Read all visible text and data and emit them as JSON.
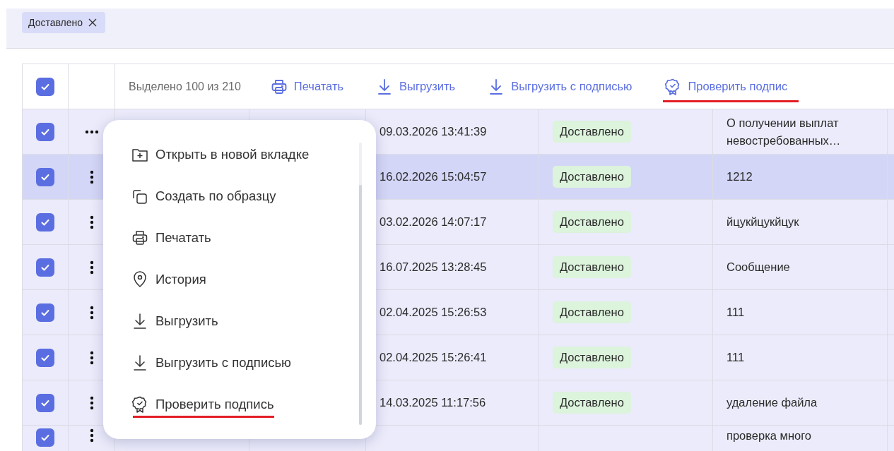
{
  "filter_chips": [
    {
      "label": "Доставлено"
    }
  ],
  "table": {
    "header": {
      "all_checked": true,
      "selection_text": "Выделено 100 из 210",
      "actions": [
        {
          "label": "Печатать",
          "underlined": false
        },
        {
          "label": "Выгрузить",
          "underlined": false
        },
        {
          "label": "Выгрузить с подписью",
          "underlined": false
        },
        {
          "label": "Проверить подпис",
          "underlined": true
        }
      ]
    },
    "rows": [
      {
        "checked": true,
        "menu_open": true,
        "highlighted": false,
        "date": "09.03.2026 13:41:39",
        "status": "Доставлено",
        "subject": "О получении выплат невостребованных…"
      },
      {
        "checked": true,
        "menu_open": false,
        "highlighted": true,
        "date": "16.02.2026 15:04:57",
        "status": "Доставлено",
        "subject": "1212"
      },
      {
        "checked": true,
        "menu_open": false,
        "highlighted": false,
        "date": "03.02.2026 14:07:17",
        "status": "Доставлено",
        "subject": "йцукйцукйцук"
      },
      {
        "checked": true,
        "menu_open": false,
        "highlighted": false,
        "date": "16.07.2025 13:28:45",
        "status": "Доставлено",
        "subject": "Сообщение"
      },
      {
        "checked": true,
        "menu_open": false,
        "highlighted": false,
        "date": "02.04.2025 15:26:53",
        "status": "Доставлено",
        "subject": "111"
      },
      {
        "checked": true,
        "menu_open": false,
        "highlighted": false,
        "date": "02.04.2025 15:26:41",
        "status": "Доставлено",
        "subject": "111"
      },
      {
        "checked": true,
        "menu_open": false,
        "highlighted": false,
        "date": "14.03.2025 11:17:56",
        "status": "Доставлено",
        "subject": "удаление файла"
      },
      {
        "checked": true,
        "menu_open": false,
        "highlighted": false,
        "subject": "проверка много"
      }
    ]
  },
  "context_menu": {
    "items": [
      {
        "label": "Открыть в новой вкладке",
        "underlined": false
      },
      {
        "label": "Создать по образцу",
        "underlined": false
      },
      {
        "label": "Печатать",
        "underlined": false
      },
      {
        "label": "История",
        "underlined": false
      },
      {
        "label": "Выгрузить",
        "underlined": false
      },
      {
        "label": "Выгрузить с подписью",
        "underlined": false
      },
      {
        "label": "Проверить подпись",
        "underlined": true
      }
    ]
  }
}
